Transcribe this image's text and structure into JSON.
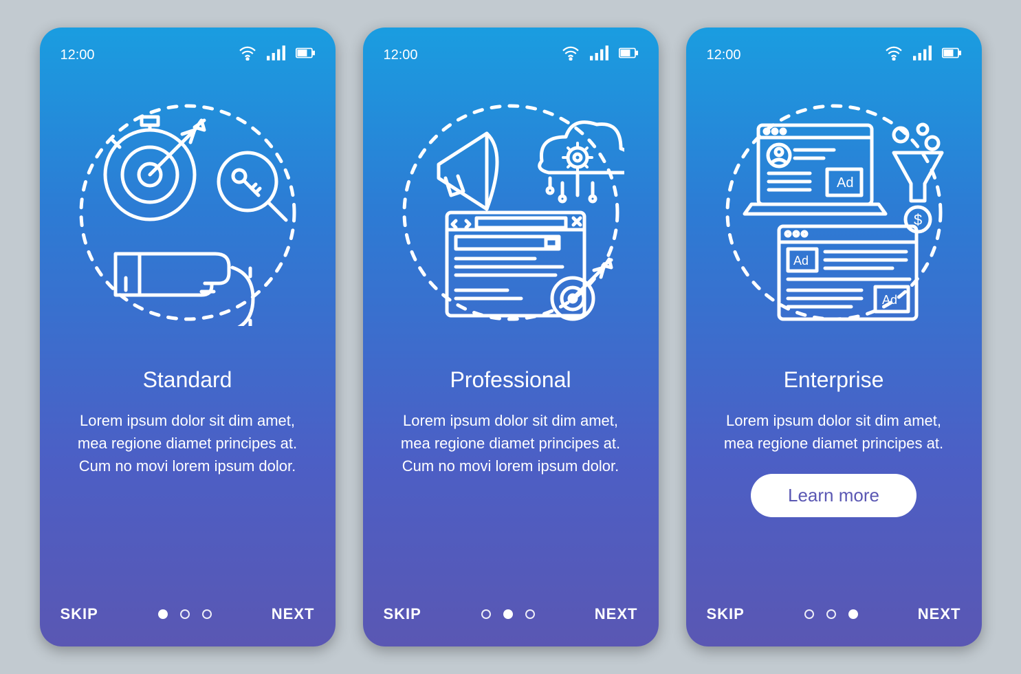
{
  "status": {
    "time": "12:00",
    "icons": [
      "wifi",
      "signal",
      "battery"
    ]
  },
  "nav": {
    "skip": "SKIP",
    "next": "NEXT"
  },
  "screens": [
    {
      "title": "Standard",
      "body": "Lorem ipsum dolor sit dim amet, mea regione diamet principes at. Cum no movi lorem ipsum dolor.",
      "activeDot": 0
    },
    {
      "title": "Professional",
      "body": "Lorem ipsum dolor sit dim amet, mea regione diamet principes at. Cum no movi lorem ipsum dolor.",
      "activeDot": 1
    },
    {
      "title": "Enterprise",
      "body": "Lorem ipsum dolor sit dim amet, mea regione diamet principes at.",
      "cta": "Learn more",
      "activeDot": 2
    }
  ]
}
